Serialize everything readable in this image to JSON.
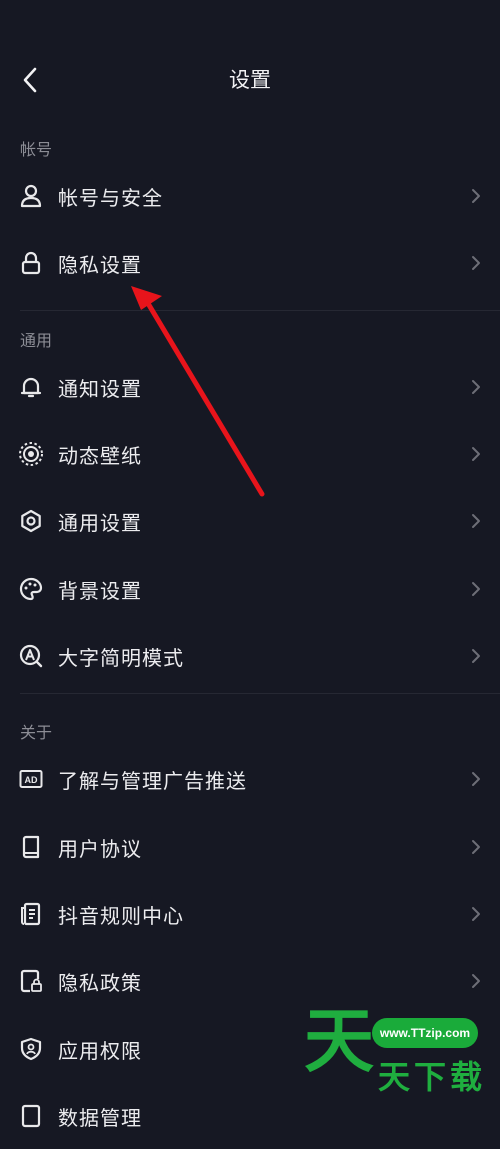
{
  "header": {
    "title": "设置"
  },
  "sections": {
    "account": "帐号",
    "general": "通用",
    "about": "关于"
  },
  "items": {
    "account_security": "帐号与安全",
    "privacy_settings": "隐私设置",
    "notification_settings": "通知设置",
    "dynamic_wallpaper": "动态壁纸",
    "general_settings": "通用设置",
    "background_settings": "背景设置",
    "large_font_mode": "大字简明模式",
    "ad_management": "了解与管理广告推送",
    "user_agreement": "用户协议",
    "rules_center": "抖音规则中心",
    "privacy_policy": "隐私政策",
    "app_permissions": "应用权限",
    "data_management": "数据管理"
  },
  "watermark": {
    "url": "www.TTzip.com",
    "big": "天",
    "small": "天下载"
  },
  "colors": {
    "background": "#161823",
    "annotation_arrow": "#e8141b",
    "watermark_green": "#1fae3f"
  }
}
